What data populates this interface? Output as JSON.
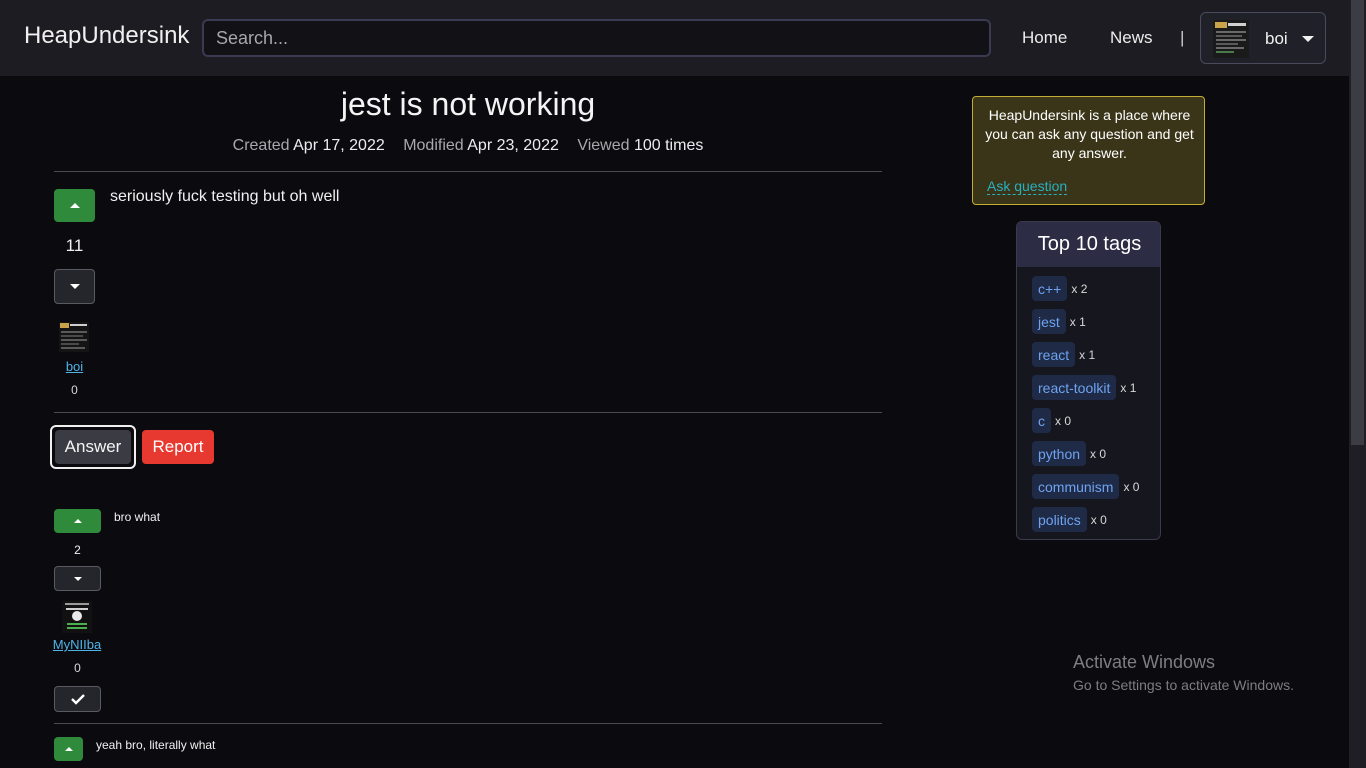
{
  "navbar": {
    "brand": "HeapUndersink",
    "search_placeholder": "Search...",
    "links": [
      "Home",
      "News"
    ],
    "separator": "|",
    "username": "boi"
  },
  "question": {
    "title": "jest is not working",
    "meta": {
      "created_label": "Created",
      "created_value": "Apr 17, 2022",
      "modified_label": "Modified",
      "modified_value": "Apr 23, 2022",
      "viewed_label": "Viewed",
      "viewed_value": "100 times"
    },
    "score": "11",
    "body": "seriously fuck testing but oh well",
    "author": "boi",
    "author_rep": "0"
  },
  "actions": {
    "answer_label": "Answer",
    "report_label": "Report"
  },
  "answers": [
    {
      "score": "2",
      "body": "bro what",
      "author": "MyNIIba",
      "author_rep": "0"
    },
    {
      "body": "yeah bro, literally what"
    }
  ],
  "sidebar": {
    "info_text": "HeapUndersink is a place where you can ask any question and get any answer.",
    "ask_label": "Ask question",
    "tags_title": "Top 10 tags",
    "tags": [
      {
        "name": "c++",
        "count": "x 2"
      },
      {
        "name": "jest",
        "count": "x 1"
      },
      {
        "name": "react",
        "count": "x 1"
      },
      {
        "name": "react-toolkit",
        "count": "x 1"
      },
      {
        "name": "c",
        "count": "x 0"
      },
      {
        "name": "python",
        "count": "x 0"
      },
      {
        "name": "communism",
        "count": "x 0"
      },
      {
        "name": "politics",
        "count": "x 0"
      }
    ]
  },
  "watermark": {
    "line1": "Activate Windows",
    "line2": "Go to Settings to activate Windows."
  },
  "colors": {
    "background": "#0b0b0f",
    "navbar": "#1c1c22",
    "upvote": "#2f8a3b",
    "report": "#e7392f",
    "link": "#4fb3e8",
    "tag_text": "#6fa3f0",
    "info_border": "#c4ad34"
  }
}
